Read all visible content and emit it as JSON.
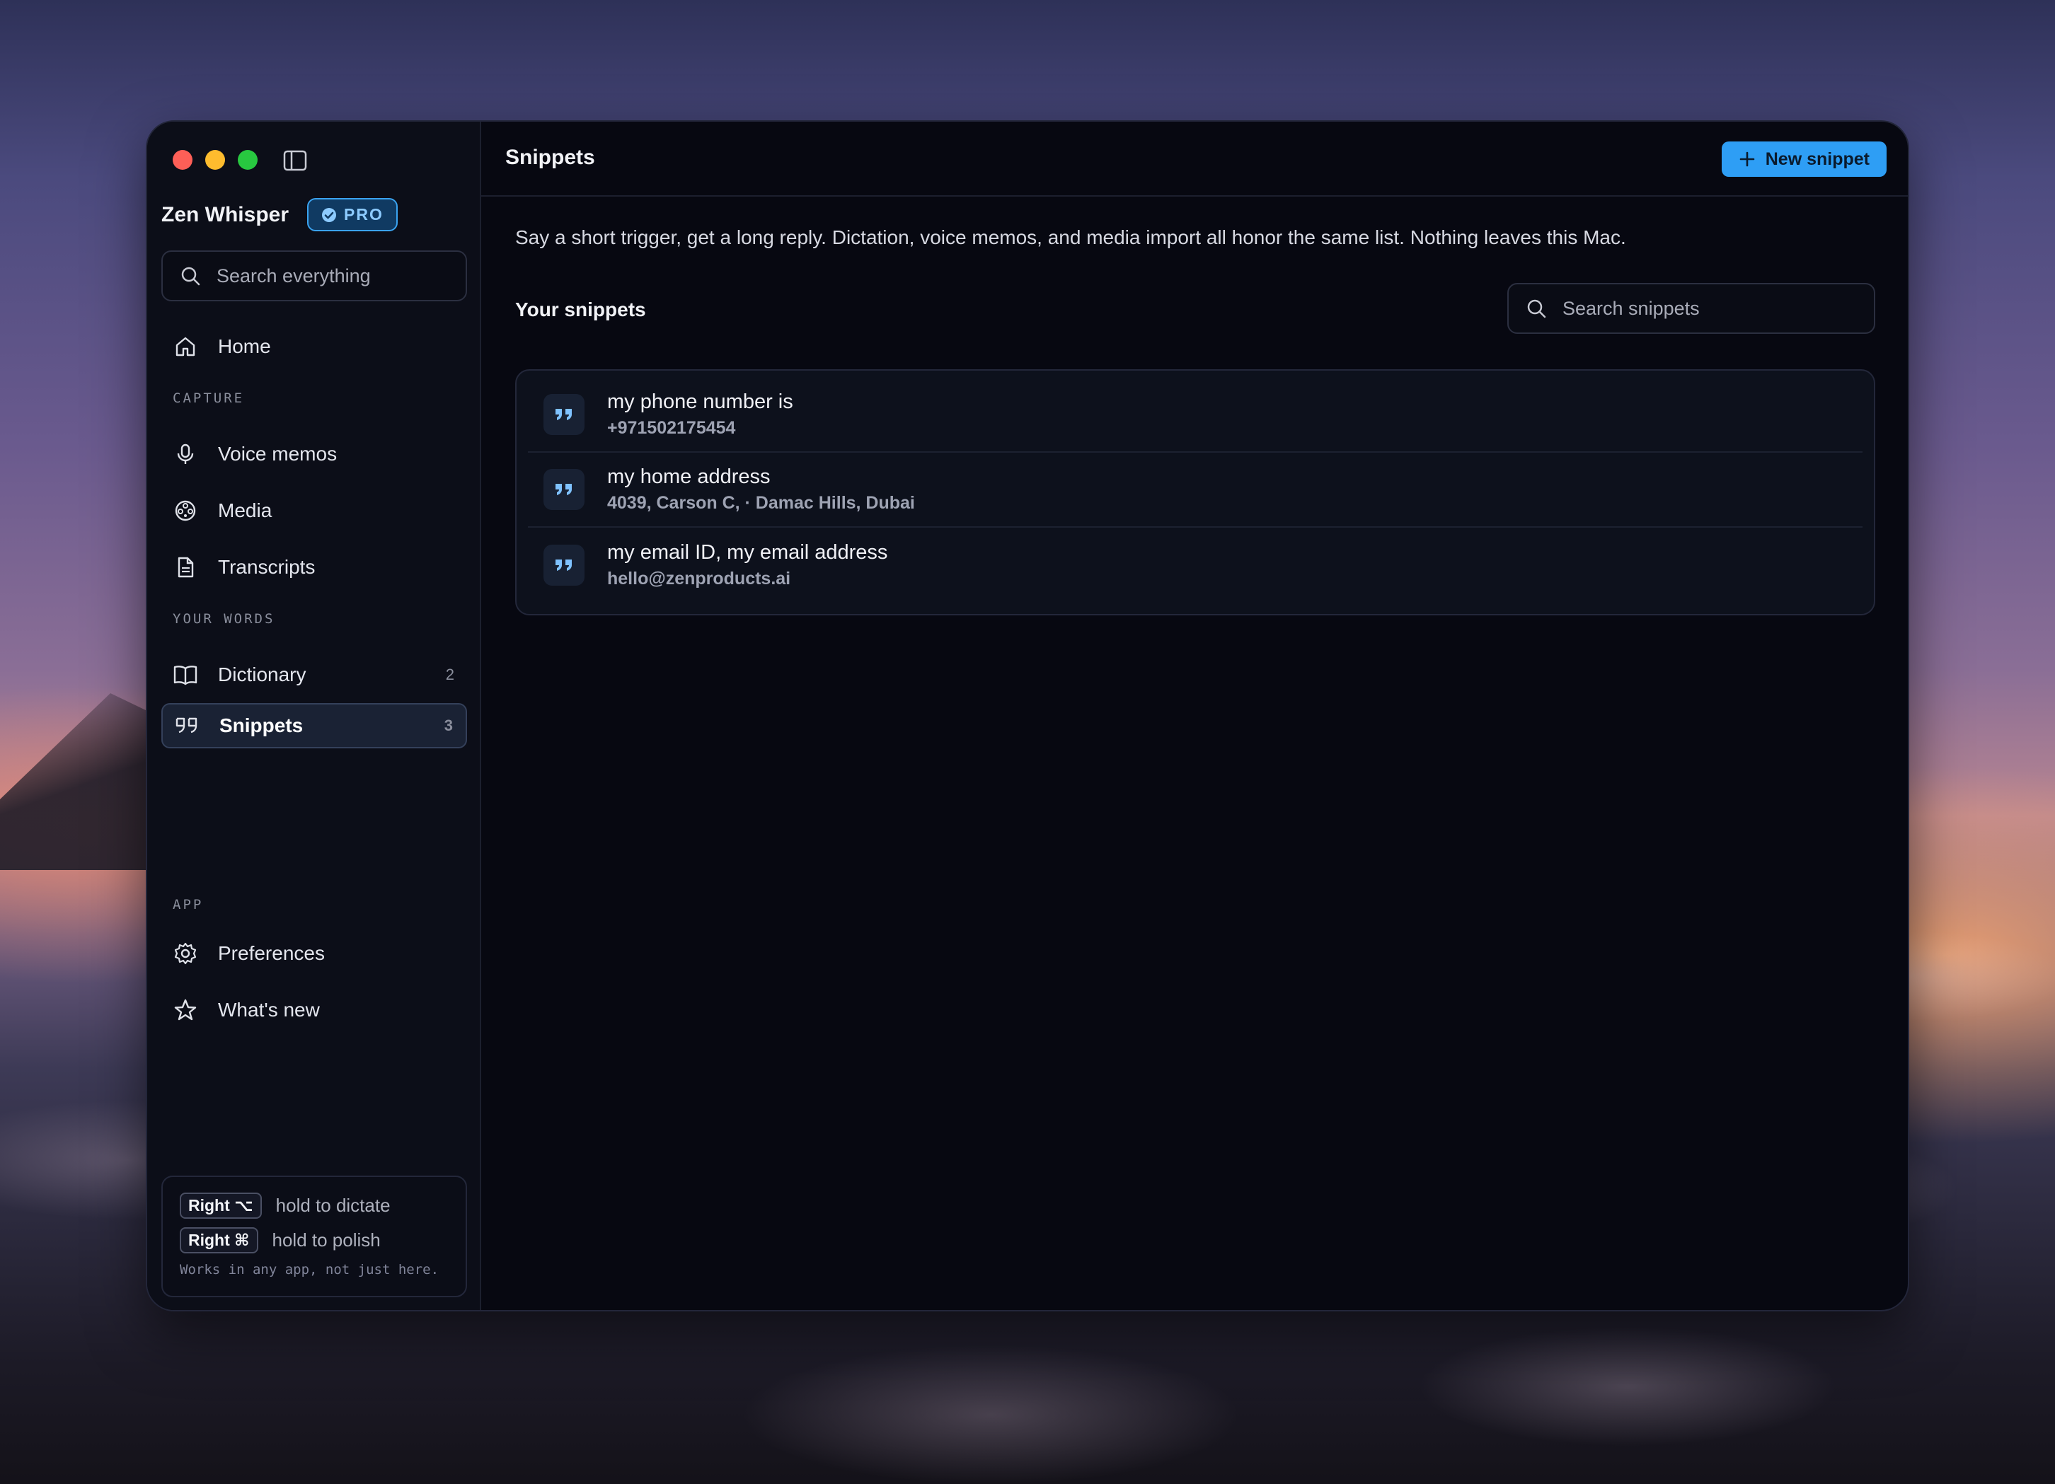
{
  "app": {
    "title": "Zen Whisper",
    "badge": "PRO"
  },
  "sidebar": {
    "search_placeholder": "Search everything",
    "home": "Home",
    "sections": {
      "capture": "CAPTURE",
      "your_words": "YOUR WORDS",
      "app": "APP"
    },
    "items": {
      "voice_memos": "Voice memos",
      "media": "Media",
      "transcripts": "Transcripts",
      "dictionary": "Dictionary",
      "dictionary_count": "2",
      "snippets": "Snippets",
      "snippets_count": "3",
      "preferences": "Preferences",
      "whats_new": "What's new"
    },
    "hints": {
      "key1": "Right ⌥",
      "text1": "hold to dictate",
      "key2": "Right ⌘",
      "text2": "hold to polish",
      "footer": "Works in any app, not just here."
    }
  },
  "main": {
    "title": "Snippets",
    "new_button": "New snippet",
    "description": "Say a short trigger, get a long reply. Dictation, voice memos, and media import all honor the same list. Nothing leaves this Mac.",
    "list_title": "Your snippets",
    "search_placeholder": "Search snippets",
    "snippets": [
      {
        "trigger": "my phone number is",
        "value": "+971502175454"
      },
      {
        "trigger": "my home address",
        "value": "4039, Carson C,  · Damac Hills, Dubai"
      },
      {
        "trigger": "my email ID, my email address",
        "value": "hello@zenproducts.ai"
      }
    ]
  },
  "colors": {
    "accent": "#2e9ef5",
    "background": "#070811",
    "sidebar": "#0c0e18"
  }
}
